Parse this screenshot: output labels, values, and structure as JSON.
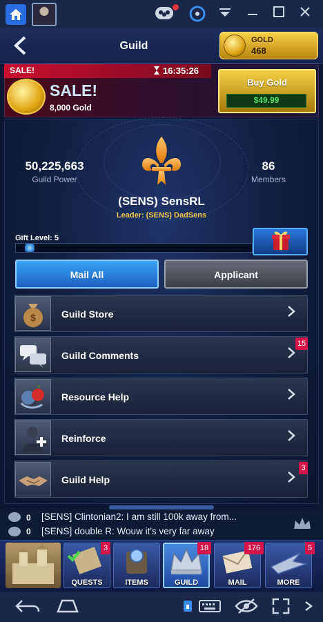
{
  "header": {
    "title": "Guild"
  },
  "gold": {
    "label": "GOLD",
    "value": "468"
  },
  "sale": {
    "tag": "SALE!",
    "timer": "16:35:26",
    "title": "SALE!",
    "amount": "8,000 Gold",
    "buy_label": "Buy Gold",
    "price": "$49.99"
  },
  "guild": {
    "power_value": "50,225,663",
    "power_label": "Guild Power",
    "members_value": "86",
    "members_label": "Members",
    "name": "(SENS) SensRL",
    "leader": "Leader: (SENS) DadSens",
    "gift_label": "Gift Level: 5",
    "gift_progress": 0.04
  },
  "actions": {
    "mail_all": "Mail All",
    "applicant": "Applicant"
  },
  "menu": [
    {
      "label": "Guild Store",
      "badge": ""
    },
    {
      "label": "Guild Comments",
      "badge": "15"
    },
    {
      "label": "Resource Help",
      "badge": ""
    },
    {
      "label": "Reinforce",
      "badge": ""
    },
    {
      "label": "Guild Help",
      "badge": "3"
    }
  ],
  "chat": [
    {
      "count": "0",
      "text": "[SENS] Clintonian2: I am still 100k away from..."
    },
    {
      "count": "0",
      "text": "[SENS] double R: Wouw it's very far away"
    }
  ],
  "nav": {
    "quests": {
      "label": "QUESTS",
      "badge": "3"
    },
    "items": {
      "label": "ITEMS",
      "badge": ""
    },
    "guild": {
      "label": "GUILD",
      "badge": "18"
    },
    "mail": {
      "label": "MAIL",
      "badge": "176"
    },
    "more": {
      "label": "MORE",
      "badge": "5"
    }
  },
  "colors": {
    "accent": "#2a6de0",
    "gold": "#f2c84b",
    "badge": "#d6144a",
    "price": "#55e06a"
  }
}
